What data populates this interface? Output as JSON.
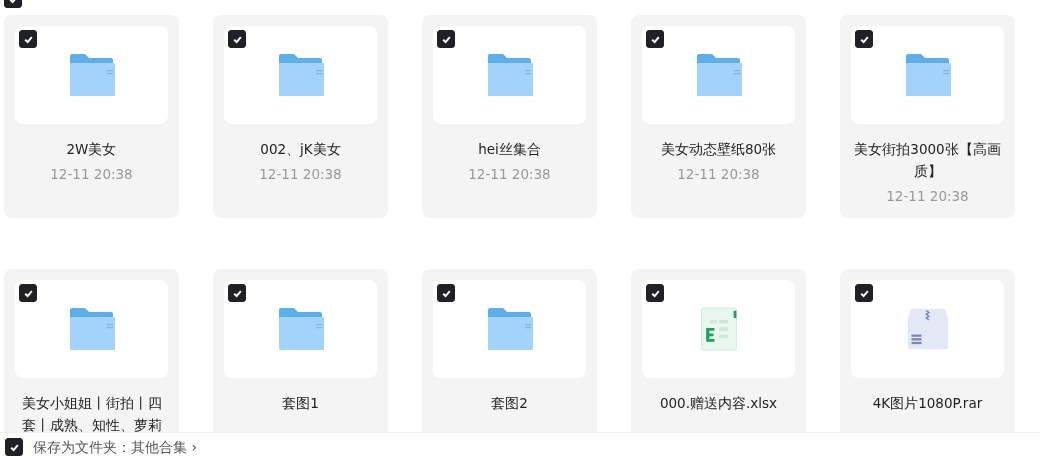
{
  "header": {
    "checked": true
  },
  "files": [
    {
      "kind": "folder",
      "name": "2W美女",
      "date": "12-11 20:38",
      "checked": true
    },
    {
      "kind": "folder",
      "name": "002、jK美女",
      "date": "12-11 20:38",
      "checked": true
    },
    {
      "kind": "folder",
      "name": "hei丝集合",
      "date": "12-11 20:38",
      "checked": true
    },
    {
      "kind": "folder",
      "name": "美女动态壁纸80张",
      "date": "12-11 20:38",
      "checked": true
    },
    {
      "kind": "folder",
      "name": "美女街拍3000张【高画质】",
      "date": "12-11 20:38",
      "checked": true
    },
    {
      "kind": "folder",
      "name": "美女小姐姐丨街拍丨四套丨成熟、知性、萝莉",
      "checked": true
    },
    {
      "kind": "folder",
      "name": "套图1",
      "checked": true
    },
    {
      "kind": "folder",
      "name": "套图2",
      "checked": true
    },
    {
      "kind": "excel",
      "name": "000.赠送内容.xlsx",
      "checked": true
    },
    {
      "kind": "archive",
      "name": "4K图片1080P.rar",
      "checked": true
    }
  ],
  "footer": {
    "checked": true,
    "label": "保存为文件夹：其他合集 ›"
  }
}
